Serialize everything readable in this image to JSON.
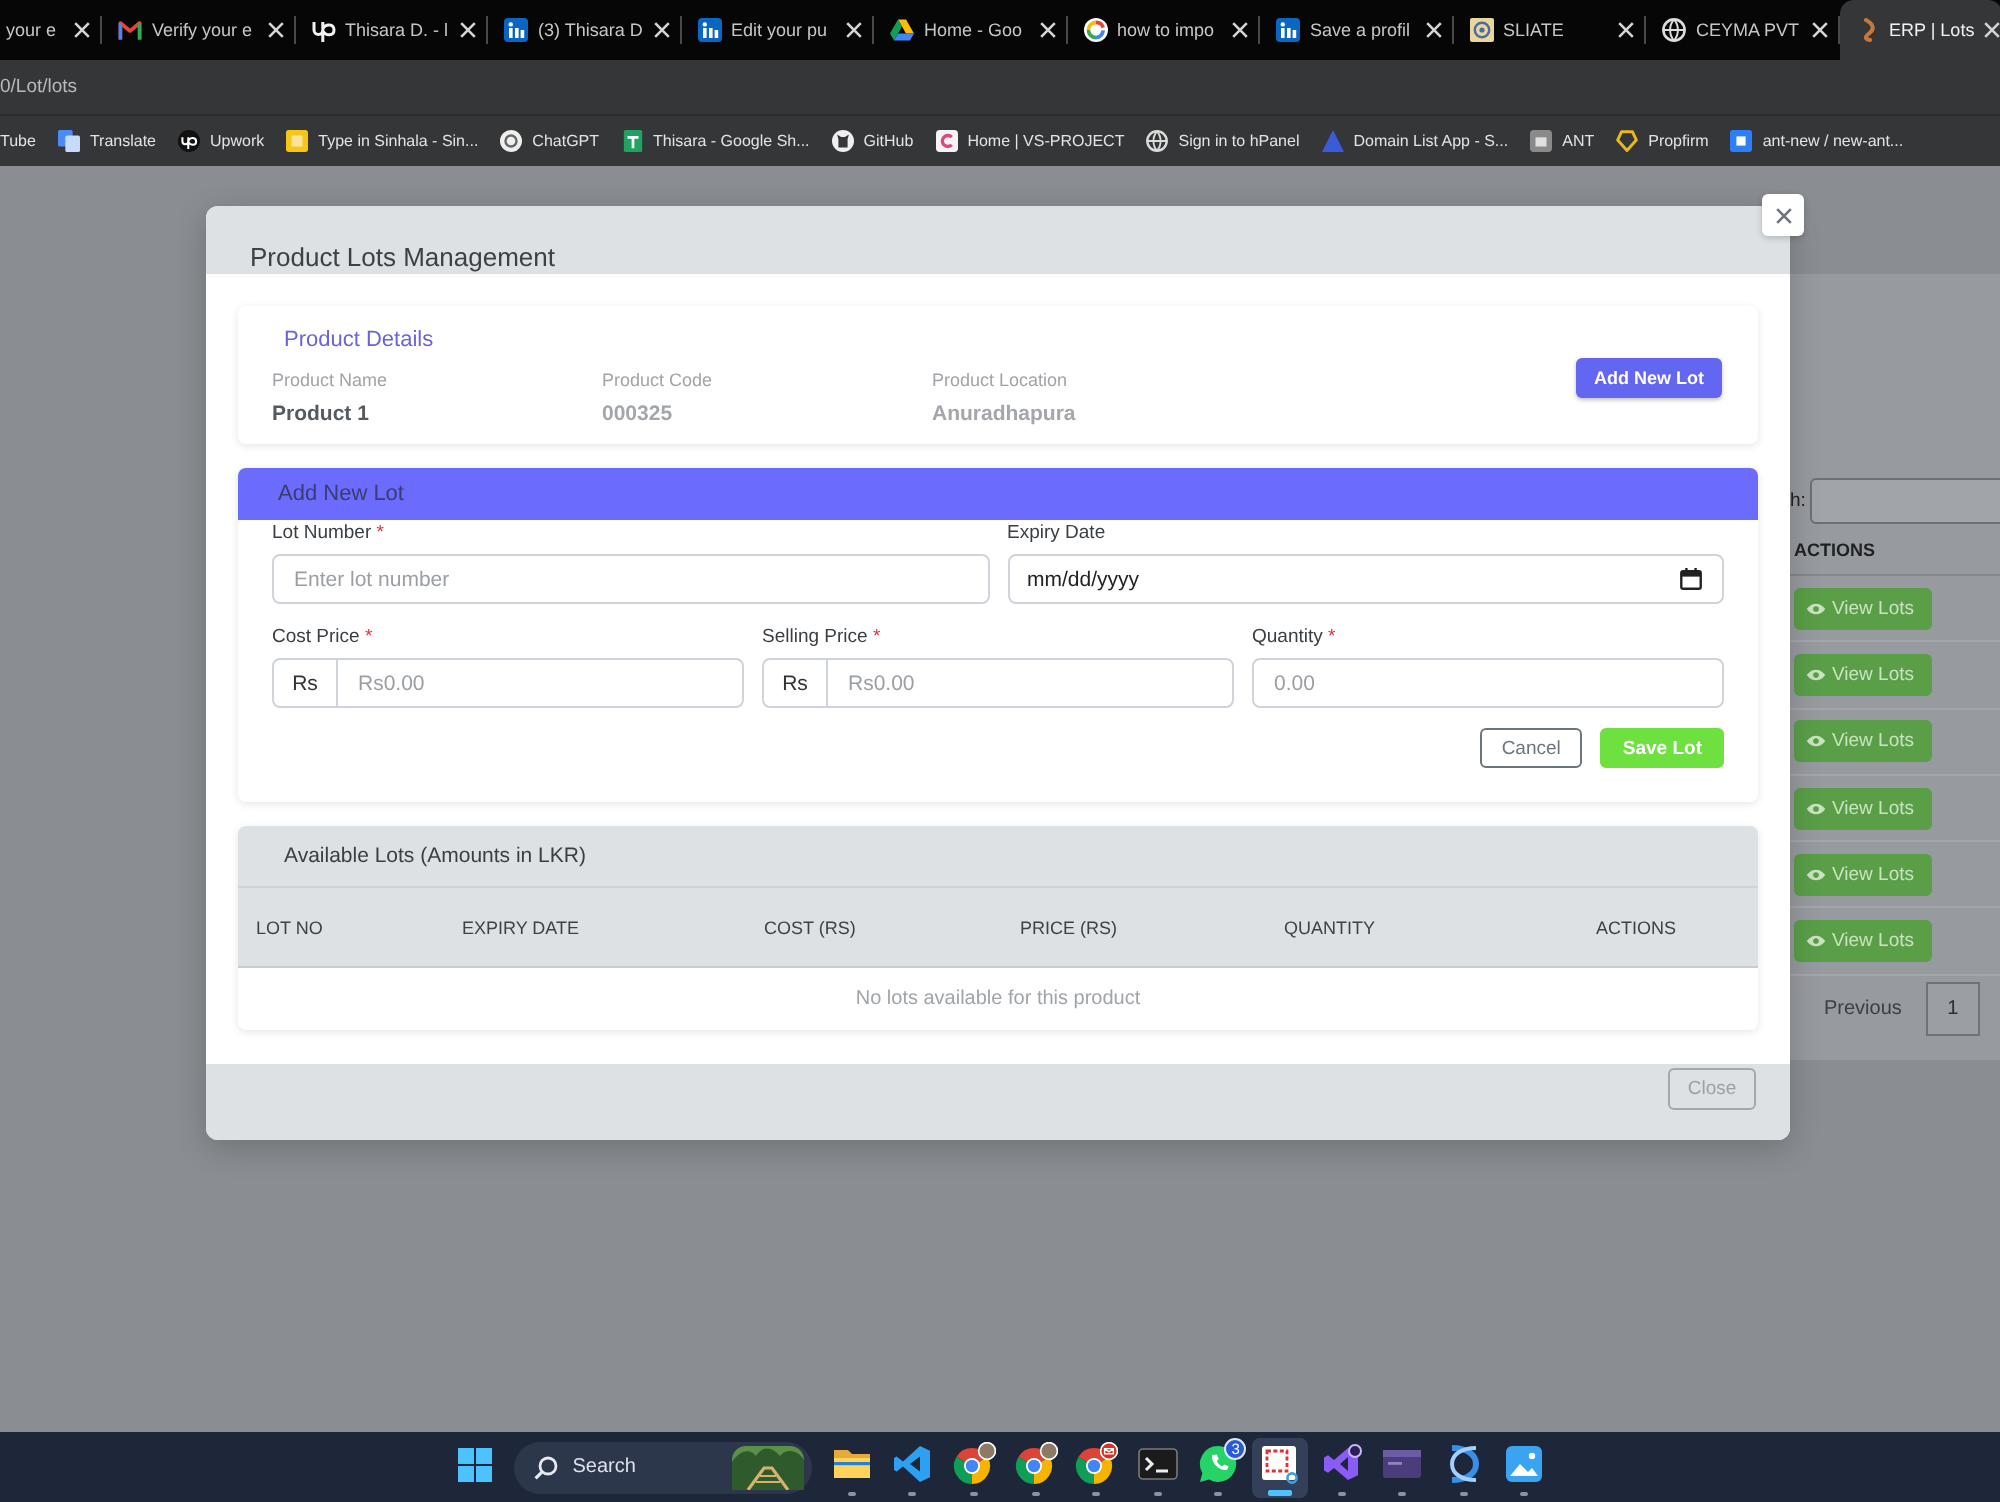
{
  "browser": {
    "tabs": [
      {
        "kind": "none",
        "title": "your e",
        "selected": false
      },
      {
        "kind": "mail",
        "title": "Verify your e",
        "selected": false
      },
      {
        "kind": "wave",
        "title": "Thisara D. - l",
        "selected": false
      },
      {
        "kind": "square",
        "title": "(3) Thisara D",
        "selected": false
      },
      {
        "kind": "square",
        "title": "Edit your pu",
        "selected": false
      },
      {
        "kind": "triangle",
        "title": "Home - Goo",
        "selected": false
      },
      {
        "kind": "ring",
        "title": "how to impo",
        "selected": false
      },
      {
        "kind": "square",
        "title": "Save a profil",
        "selected": false
      },
      {
        "kind": "emblem",
        "title": "SLIATE",
        "selected": false
      },
      {
        "kind": "globe",
        "title": "CEYMA PVT",
        "selected": false
      },
      {
        "kind": "swirl",
        "title": "ERP | Lots",
        "selected": true
      }
    ],
    "address": "0/Lot/lots",
    "bookmarks": [
      {
        "kind": "none",
        "label": "Tube"
      },
      {
        "kind": "document",
        "label": "Translate"
      },
      {
        "kind": "circle",
        "label": "Upwork"
      },
      {
        "kind": "tile",
        "label": "Type in Sinhala - Sin..."
      },
      {
        "kind": "knot",
        "label": "ChatGPT"
      },
      {
        "kind": "sheet",
        "label": "Thisara - Google Sh..."
      },
      {
        "kind": "round",
        "label": "GitHub"
      },
      {
        "kind": "arc",
        "label": "Home | VS-PROJECT"
      },
      {
        "kind": "globe",
        "label": "Sign in to hPanel"
      },
      {
        "kind": "triangle",
        "label": "Domain List App - S..."
      },
      {
        "kind": "box",
        "label": "ANT"
      },
      {
        "kind": "shield",
        "label": "Propfirm"
      },
      {
        "kind": "square",
        "label": "ant-new / new-ant..."
      }
    ]
  },
  "background_page": {
    "search_label": "h:",
    "column_header": "ACTIONS",
    "rows": [
      {
        "action": "View Lots"
      },
      {
        "action": "View Lots"
      },
      {
        "action": "View Lots"
      },
      {
        "action": "View Lots"
      },
      {
        "action": "View Lots"
      },
      {
        "action": "View Lots"
      }
    ],
    "pagination": {
      "previous": "Previous",
      "pages": [
        "1"
      ]
    }
  },
  "modal": {
    "title": "Product Lots Management",
    "product_details": {
      "heading": "Product Details",
      "fields": [
        {
          "label": "Product Name",
          "value": "Product 1",
          "muted": false
        },
        {
          "label": "Product Code",
          "value": "000325",
          "muted": true
        },
        {
          "label": "Product Location",
          "value": "Anuradhapura",
          "muted": true
        }
      ],
      "add_button": "Add New Lot"
    },
    "add_lot_form": {
      "title": "Add New Lot",
      "rows": [
        [
          {
            "kind": "text",
            "label": "Lot Number",
            "required_mark": "*",
            "placeholder": "Enter lot number"
          },
          {
            "kind": "date",
            "label": "Expiry Date",
            "placeholder": "mm/dd/yyyy"
          }
        ],
        [
          {
            "kind": "currency",
            "label": "Cost Price",
            "required_mark": "*",
            "prefix": "Rs",
            "placeholder": "Rs0.00"
          },
          {
            "kind": "currency",
            "label": "Selling Price",
            "required_mark": "*",
            "prefix": "Rs",
            "placeholder": "Rs0.00"
          },
          {
            "kind": "text",
            "label": "Quantity",
            "required_mark": "*",
            "placeholder": "0.00"
          }
        ]
      ],
      "buttons": [
        {
          "kind": "cancel",
          "label": "Cancel"
        },
        {
          "kind": "save",
          "label": "Save Lot"
        }
      ]
    },
    "lots_table": {
      "title": "Available Lots (Amounts in LKR)",
      "columns": [
        "LOT NO",
        "EXPIRY DATE",
        "COST (RS)",
        "PRICE (RS)",
        "QUANTITY",
        "ACTIONS"
      ],
      "empty_message": "No lots available for this product"
    },
    "footer_button": "Close"
  },
  "taskbar": {
    "search_placeholder": "Search",
    "apps": [
      {
        "kind": "folder",
        "selected": false
      },
      {
        "kind": "editor",
        "selected": false
      },
      {
        "kind": "browser-photo",
        "selected": false
      },
      {
        "kind": "browser-photo",
        "selected": false
      },
      {
        "kind": "browser-mail",
        "selected": false
      },
      {
        "kind": "terminal",
        "selected": false
      },
      {
        "kind": "chat",
        "selected": false,
        "badge": "3"
      },
      {
        "kind": "snip",
        "selected": true
      },
      {
        "kind": "studio",
        "selected": false
      },
      {
        "kind": "window",
        "selected": false
      },
      {
        "kind": "strands",
        "selected": false
      },
      {
        "kind": "photos",
        "selected": false
      }
    ]
  }
}
